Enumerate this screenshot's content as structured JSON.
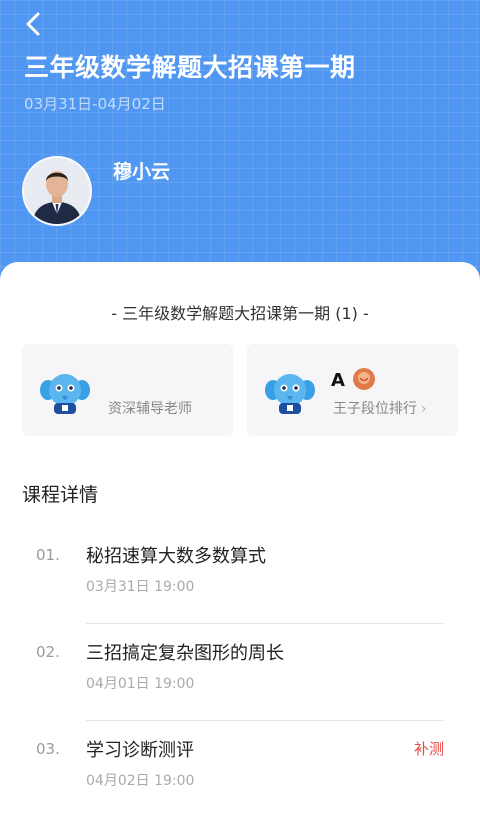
{
  "header": {
    "title": "三年级数学解题大招课第一期",
    "date_range": "03月31日-04月02日",
    "teacher_name": "穆小云"
  },
  "course_subtitle": "- 三年级数学解题大招课第一期 (1) -",
  "info_boxes": {
    "tutor_label": "资深辅导老师",
    "rank_letter": "A",
    "rank_label": "王子段位排行"
  },
  "icons": {
    "back": "chevron-left-icon",
    "mascot": "elephant-mascot-icon",
    "rank": "rank-badge-icon",
    "chevron": "chevron-right-icon"
  },
  "colors": {
    "header_blue": "#4f97f2",
    "tag_red": "#e84b46"
  },
  "section_title": "课程详情",
  "lessons": [
    {
      "num": "01.",
      "title": "秘招速算大数多数算式",
      "time": "03月31日 19:00",
      "tag": ""
    },
    {
      "num": "02.",
      "title": "三招搞定复杂图形的周长",
      "time": "04月01日 19:00",
      "tag": ""
    },
    {
      "num": "03.",
      "title": "学习诊断测评",
      "time": "04月02日 19:00",
      "tag": "补测"
    }
  ]
}
